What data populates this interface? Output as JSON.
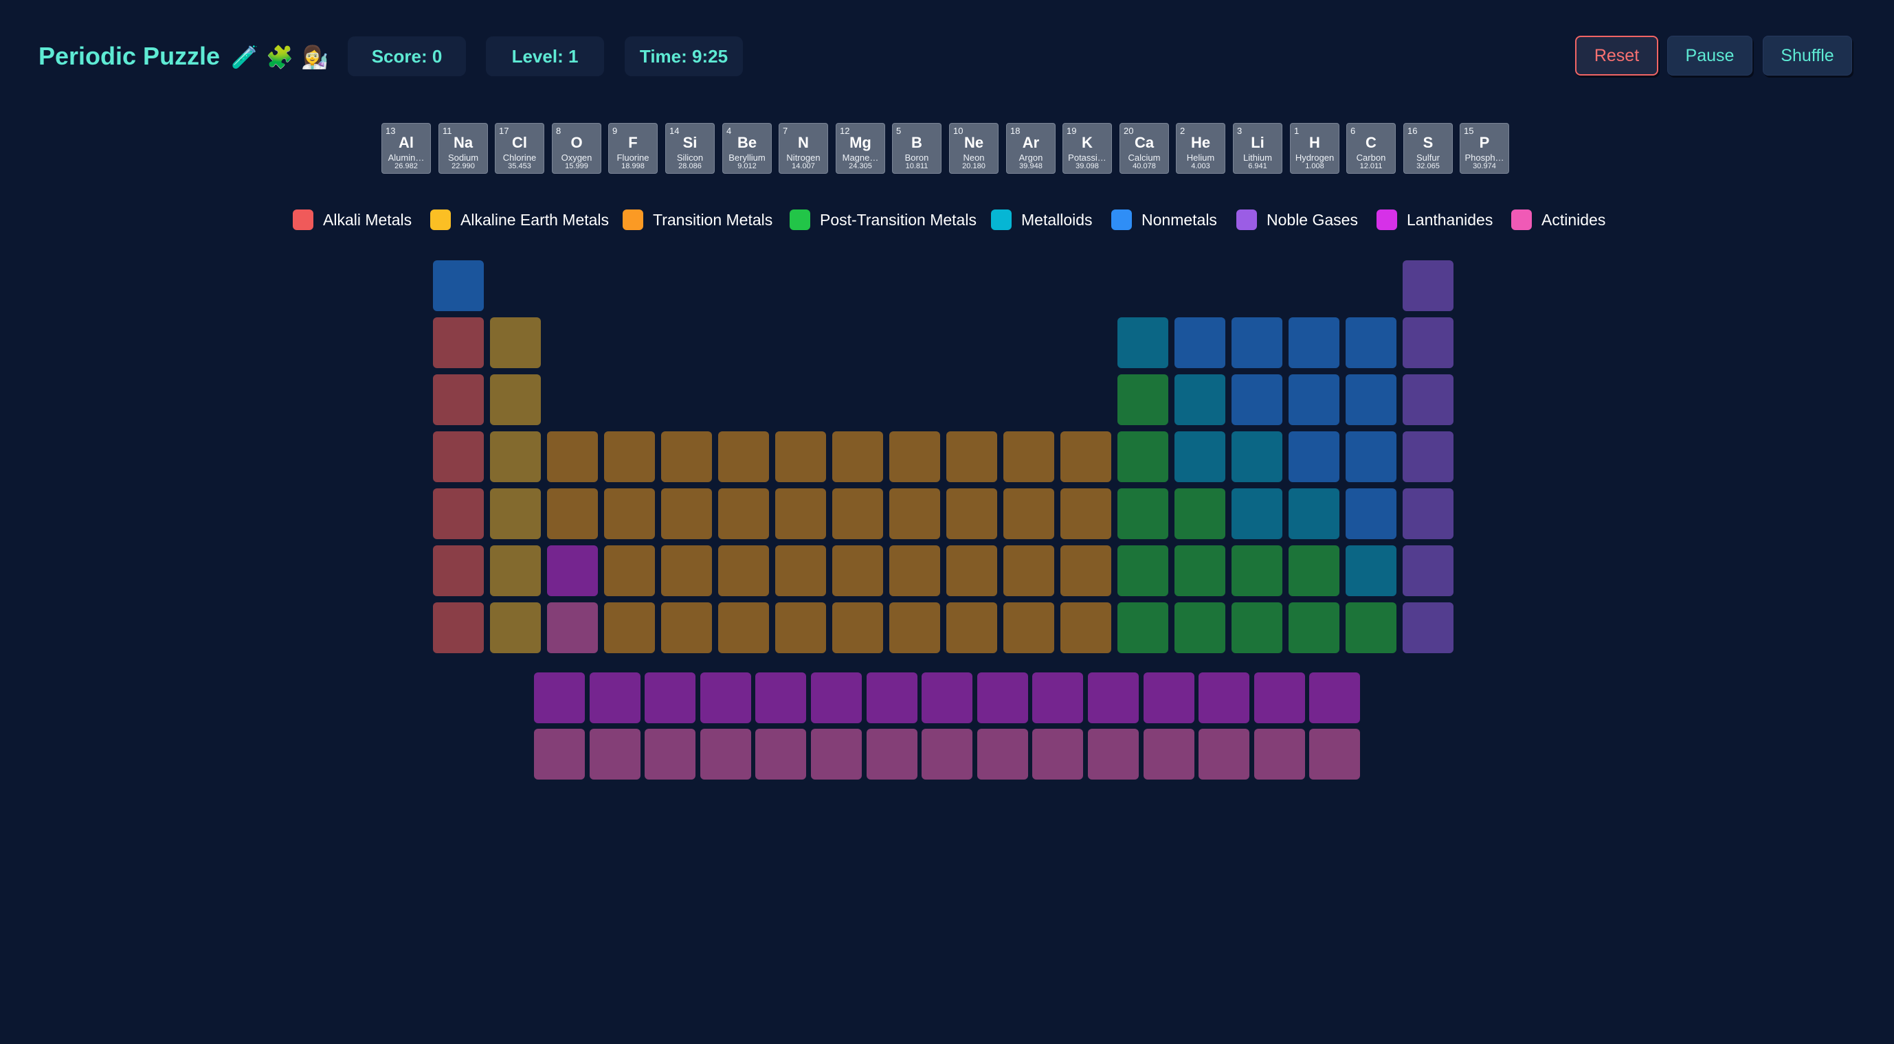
{
  "header": {
    "title": "Periodic Puzzle",
    "title_emoji": "🧪 🧩 👩‍🔬",
    "score": "Score: 0",
    "level": "Level: 1",
    "time": "Time: 9:25",
    "buttons": {
      "reset": "Reset",
      "pause": "Pause",
      "shuffle": "Shuffle"
    }
  },
  "tray": [
    {
      "number": "13",
      "symbol": "Al",
      "name": "Alumin…",
      "weight": "26.982"
    },
    {
      "number": "11",
      "symbol": "Na",
      "name": "Sodium",
      "weight": "22.990"
    },
    {
      "number": "17",
      "symbol": "Cl",
      "name": "Chlorine",
      "weight": "35.453"
    },
    {
      "number": "8",
      "symbol": "O",
      "name": "Oxygen",
      "weight": "15.999"
    },
    {
      "number": "9",
      "symbol": "F",
      "name": "Fluorine",
      "weight": "18.998"
    },
    {
      "number": "14",
      "symbol": "Si",
      "name": "Silicon",
      "weight": "28.086"
    },
    {
      "number": "4",
      "symbol": "Be",
      "name": "Beryllium",
      "weight": "9.012"
    },
    {
      "number": "7",
      "symbol": "N",
      "name": "Nitrogen",
      "weight": "14.007"
    },
    {
      "number": "12",
      "symbol": "Mg",
      "name": "Magne…",
      "weight": "24.305"
    },
    {
      "number": "5",
      "symbol": "B",
      "name": "Boron",
      "weight": "10.811"
    },
    {
      "number": "10",
      "symbol": "Ne",
      "name": "Neon",
      "weight": "20.180"
    },
    {
      "number": "18",
      "symbol": "Ar",
      "name": "Argon",
      "weight": "39.948"
    },
    {
      "number": "19",
      "symbol": "K",
      "name": "Potassi…",
      "weight": "39.098"
    },
    {
      "number": "20",
      "symbol": "Ca",
      "name": "Calcium",
      "weight": "40.078"
    },
    {
      "number": "2",
      "symbol": "He",
      "name": "Helium",
      "weight": "4.003"
    },
    {
      "number": "3",
      "symbol": "Li",
      "name": "Lithium",
      "weight": "6.941"
    },
    {
      "number": "1",
      "symbol": "H",
      "name": "Hydrogen",
      "weight": "1.008"
    },
    {
      "number": "6",
      "symbol": "C",
      "name": "Carbon",
      "weight": "12.011"
    },
    {
      "number": "16",
      "symbol": "S",
      "name": "Sulfur",
      "weight": "32.065"
    },
    {
      "number": "15",
      "symbol": "P",
      "name": "Phosph…",
      "weight": "30.974"
    }
  ],
  "legend": [
    {
      "key": "alkali",
      "label": "Alkali Metals",
      "color": "#f05a5a"
    },
    {
      "key": "alkaline",
      "label": "Alkaline Earth Metals",
      "color": "#fbbf24"
    },
    {
      "key": "transition",
      "label": "Transition Metals",
      "color": "#fb9a24"
    },
    {
      "key": "post",
      "label": "Post-Transition Metals",
      "color": "#22c548"
    },
    {
      "key": "metalloid",
      "label": "Metalloids",
      "color": "#06b6d4"
    },
    {
      "key": "nonmetal",
      "label": "Nonmetals",
      "color": "#2f8ef6"
    },
    {
      "key": "noble",
      "label": "Noble Gases",
      "color": "#9b5de5"
    },
    {
      "key": "lanthanide",
      "label": "Lanthanides",
      "color": "#d631e8"
    },
    {
      "key": "actinide",
      "label": "Actinides",
      "color": "#f05ab6"
    }
  ],
  "board_colors": {
    "alkali": "#8a3e47",
    "alkaline": "#836a2e",
    "transition": "#835c26",
    "post": "#1c7439",
    "metalloid": "#0b6685",
    "nonmetal": "#1b559c",
    "noble": "#533d8f",
    "lanthanide": "#75258f",
    "actinide": "#843f77"
  },
  "board": {
    "main": [
      [
        "nonmetal",
        "",
        "",
        "",
        "",
        "",
        "",
        "",
        "",
        "",
        "",
        "",
        "",
        "",
        "",
        "",
        "",
        "noble"
      ],
      [
        "alkali",
        "alkaline",
        "",
        "",
        "",
        "",
        "",
        "",
        "",
        "",
        "",
        "",
        "metalloid",
        "nonmetal",
        "nonmetal",
        "nonmetal",
        "nonmetal",
        "noble"
      ],
      [
        "alkali",
        "alkaline",
        "",
        "",
        "",
        "",
        "",
        "",
        "",
        "",
        "",
        "",
        "post",
        "metalloid",
        "nonmetal",
        "nonmetal",
        "nonmetal",
        "noble"
      ],
      [
        "alkali",
        "alkaline",
        "transition",
        "transition",
        "transition",
        "transition",
        "transition",
        "transition",
        "transition",
        "transition",
        "transition",
        "transition",
        "post",
        "metalloid",
        "metalloid",
        "nonmetal",
        "nonmetal",
        "noble"
      ],
      [
        "alkali",
        "alkaline",
        "transition",
        "transition",
        "transition",
        "transition",
        "transition",
        "transition",
        "transition",
        "transition",
        "transition",
        "transition",
        "post",
        "post",
        "metalloid",
        "metalloid",
        "nonmetal",
        "noble"
      ],
      [
        "alkali",
        "alkaline",
        "lanthanide",
        "transition",
        "transition",
        "transition",
        "transition",
        "transition",
        "transition",
        "transition",
        "transition",
        "transition",
        "post",
        "post",
        "post",
        "post",
        "metalloid",
        "noble"
      ],
      [
        "alkali",
        "alkaline",
        "actinide",
        "transition",
        "transition",
        "transition",
        "transition",
        "transition",
        "transition",
        "transition",
        "transition",
        "transition",
        "post",
        "post",
        "post",
        "post",
        "post",
        "noble"
      ]
    ],
    "f_block": [
      [
        "lanthanide",
        "lanthanide",
        "lanthanide",
        "lanthanide",
        "lanthanide",
        "lanthanide",
        "lanthanide",
        "lanthanide",
        "lanthanide",
        "lanthanide",
        "lanthanide",
        "lanthanide",
        "lanthanide",
        "lanthanide",
        "lanthanide"
      ],
      [
        "actinide",
        "actinide",
        "actinide",
        "actinide",
        "actinide",
        "actinide",
        "actinide",
        "actinide",
        "actinide",
        "actinide",
        "actinide",
        "actinide",
        "actinide",
        "actinide",
        "actinide"
      ]
    ]
  }
}
